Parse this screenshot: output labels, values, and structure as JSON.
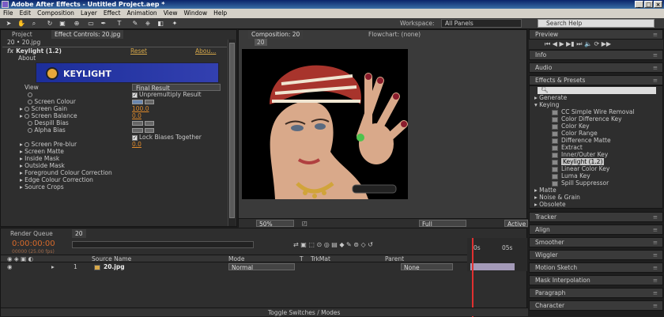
{
  "window": {
    "title": "Adobe After Effects - Untitled Project.aep *",
    "buttons": [
      "_",
      "□",
      "×"
    ]
  },
  "menu": [
    "File",
    "Edit",
    "Composition",
    "Layer",
    "Effect",
    "Animation",
    "View",
    "Window",
    "Help"
  ],
  "toolbar": {
    "workspace_label": "Workspace:",
    "workspace_value": "All Panels",
    "search_placeholder": "Search Help"
  },
  "project": {
    "tab": "Project",
    "effect_tab": "Effect Controls: 20.jpg",
    "breadcrumb": "20 • 20.jpg"
  },
  "effect": {
    "name": "Keylight (1.2)",
    "reset": "Reset",
    "about_link": "Abou...",
    "about_label": "About",
    "logo_text": "KEYLIGHT",
    "view_label": "View",
    "view_value": "Final Result",
    "unpremultiply": "Unpremultiply Result",
    "screen_colour": "Screen Colour",
    "screen_gain": "Screen Gain",
    "screen_gain_value": "100.0",
    "screen_balance": "Screen Balance",
    "screen_balance_value": "0.0",
    "despill_bias": "Despill Bias",
    "alpha_bias": "Alpha Bias",
    "lock_biases": "Lock Biases Together",
    "screen_preblur": "Screen Pre-blur",
    "screen_preblur_value": "0.0",
    "groups": [
      "Screen Matte",
      "Inside Mask",
      "Outside Mask",
      "Foreground Colour Correction",
      "Edge Colour Correction",
      "Source Crops"
    ]
  },
  "composition": {
    "tab": "Composition: 20",
    "flowchart_tab": "Flowchart: (none)",
    "comp_label": "20",
    "zoom": "50%",
    "timecode": "0:00:00:00",
    "resolution": "Full",
    "camera": "Active"
  },
  "right_panel": {
    "preview": "Preview",
    "info": "Info",
    "audio": "Audio",
    "effects_presets": "Effects & Presets",
    "categories": [
      "Generate",
      "Keying"
    ],
    "keying_items": [
      "CC Simple Wire Removal",
      "Color Difference Key",
      "Color Key",
      "Color Range",
      "Difference Matte",
      "Extract",
      "Inner/Outer Key",
      "Keylight (1.2)",
      "Linear Color Key",
      "Luma Key",
      "Spill Suppressor"
    ],
    "more_categories": [
      "Matte",
      "Noise & Grain",
      "Obsolete"
    ],
    "collapsed_panels": [
      "Tracker",
      "Align",
      "Smoother",
      "Wiggler",
      "Motion Sketch",
      "Mask Interpolation",
      "Paragraph",
      "Character"
    ]
  },
  "timeline": {
    "render_queue_tab": "Render Queue",
    "comp_tab": "20",
    "timecode": "0:00:00:00",
    "fps": "00000 (25.00 fps)",
    "columns": {
      "source_name": "Source Name",
      "mode": "Mode",
      "t": "T",
      "trkmat": "TrkMat",
      "parent": "Parent"
    },
    "layer": {
      "index": "1",
      "name": "20.jpg",
      "mode": "Normal",
      "parent": "None"
    },
    "ruler": [
      "0s",
      "05s"
    ],
    "toggle": "Toggle Switches / Modes"
  },
  "colors": {
    "accent_blue": "#2a3fa8",
    "keylight_yellow": "#d8a94a"
  }
}
